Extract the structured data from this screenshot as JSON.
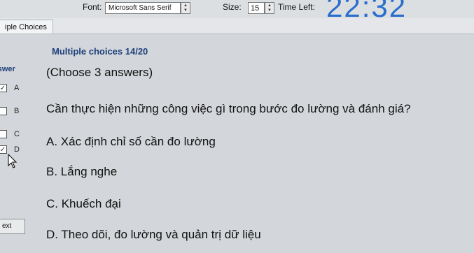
{
  "toolbar": {
    "font_label": "Font:",
    "font_value": "Microsoft Sans Serif",
    "size_label": "Size:",
    "size_value": "15",
    "time_left_label": "Time Left:",
    "time_value": "22:32"
  },
  "tab": {
    "label": "iple Choices"
  },
  "panel": {
    "title": "Multiple choices 14/20"
  },
  "sidebar": {
    "header": "nswer",
    "options": [
      "A",
      "B",
      "C",
      "D"
    ],
    "checked": [
      true,
      false,
      false,
      true
    ],
    "next_label": "ext"
  },
  "question": {
    "instruction": "(Choose 3 answers)",
    "text": "Cần thực hiện những công việc gì trong bước đo lường và đánh giá?",
    "answers": [
      "A. Xác định chỉ số cần đo lường",
      "B. Lắng nghe",
      "C. Khuếch đại",
      "D. Theo dõi, đo lường và quản trị dữ liệu"
    ]
  }
}
